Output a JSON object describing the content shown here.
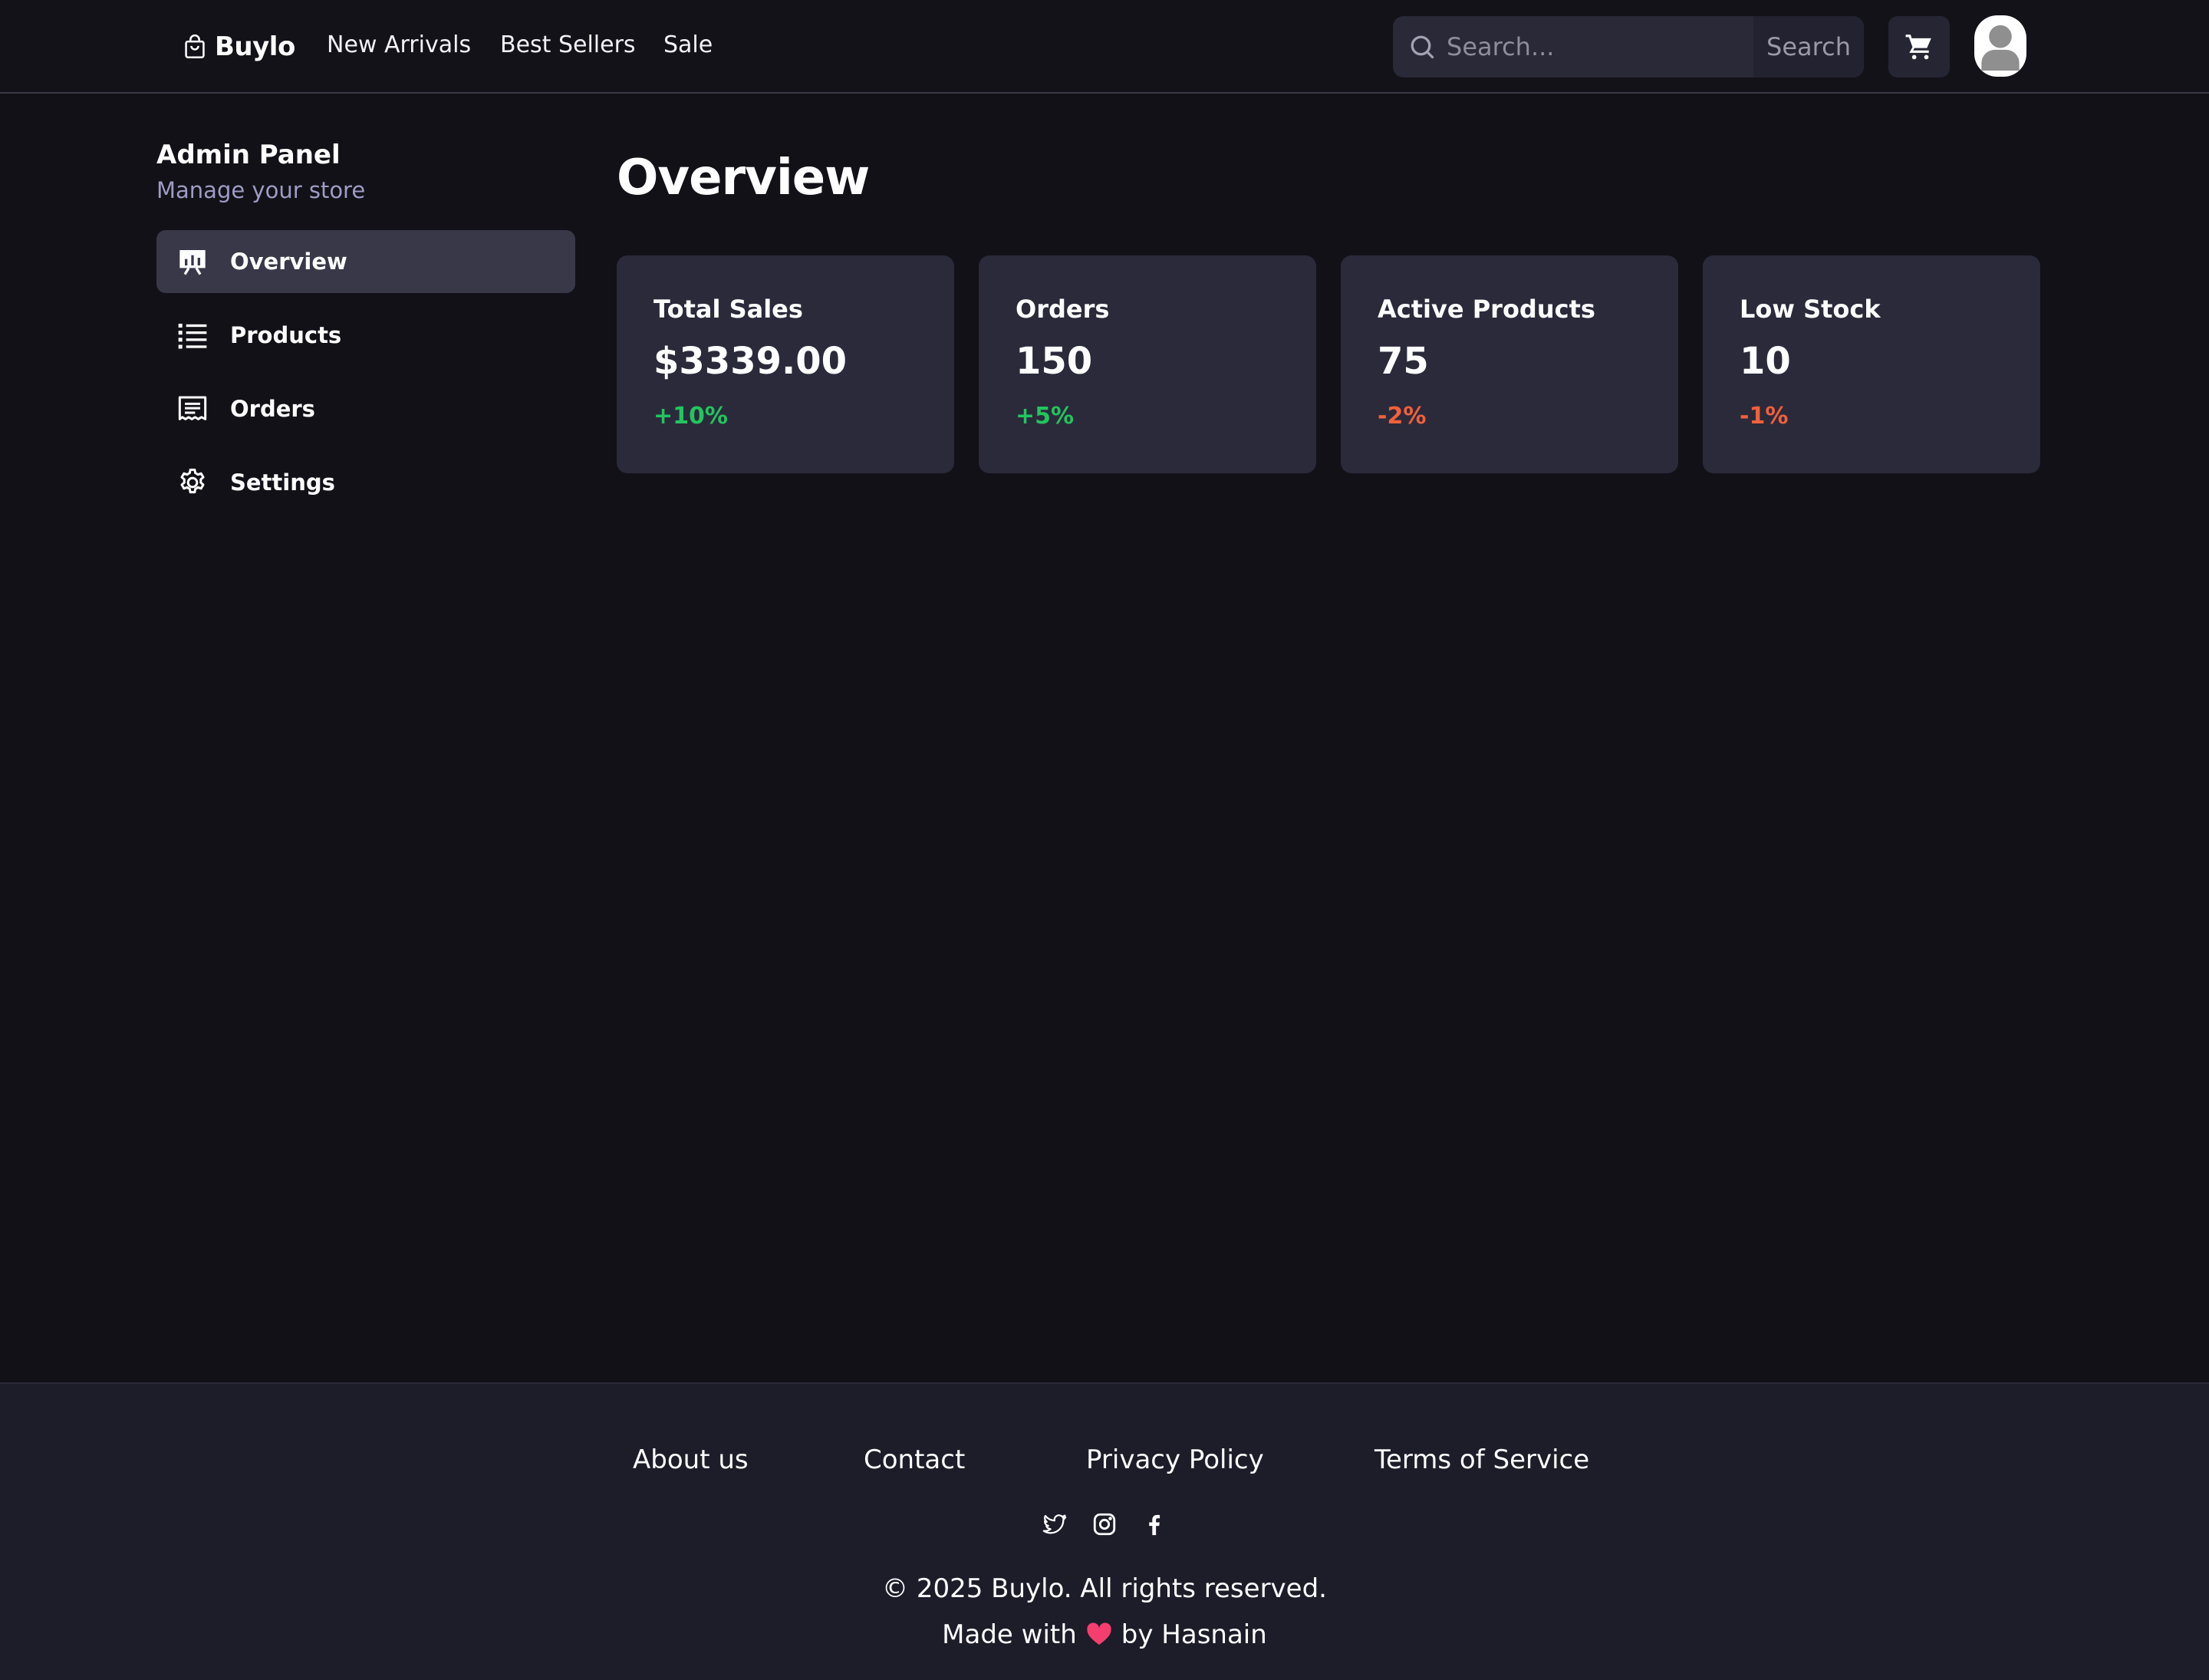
{
  "header": {
    "brand": "Buylo",
    "nav": [
      "New Arrivals",
      "Best Sellers",
      "Sale"
    ],
    "search": {
      "placeholder": "Search...",
      "button_label": "Search"
    }
  },
  "sidebar": {
    "title": "Admin Panel",
    "subtitle": "Manage your store",
    "items": [
      {
        "label": "Overview",
        "icon": "presentation-chart-icon",
        "active": true
      },
      {
        "label": "Products",
        "icon": "list-icon",
        "active": false
      },
      {
        "label": "Orders",
        "icon": "receipt-icon",
        "active": false
      },
      {
        "label": "Settings",
        "icon": "gear-icon",
        "active": false
      }
    ]
  },
  "main": {
    "title": "Overview",
    "stats": [
      {
        "title": "Total Sales",
        "value": "$3339.00",
        "change": "+10%",
        "trend": "up"
      },
      {
        "title": "Orders",
        "value": "150",
        "change": "+5%",
        "trend": "up"
      },
      {
        "title": "Active Products",
        "value": "75",
        "change": "-2%",
        "trend": "down"
      },
      {
        "title": "Low Stock",
        "value": "10",
        "change": "-1%",
        "trend": "down"
      }
    ]
  },
  "footer": {
    "links": [
      "About us",
      "Contact",
      "Privacy Policy",
      "Terms of Service"
    ],
    "social": [
      "twitter-icon",
      "instagram-icon",
      "facebook-icon"
    ],
    "copyright": "© 2025 Buylo. All rights reserved.",
    "made_with_prefix": "Made with",
    "made_with_suffix": "by Hasnain"
  },
  "colors": {
    "background": "#121118",
    "card": "#2b2a3b",
    "active_item": "#393848",
    "positive": "#22c55e",
    "negative": "#f0613c",
    "heart": "#f43f6e"
  }
}
